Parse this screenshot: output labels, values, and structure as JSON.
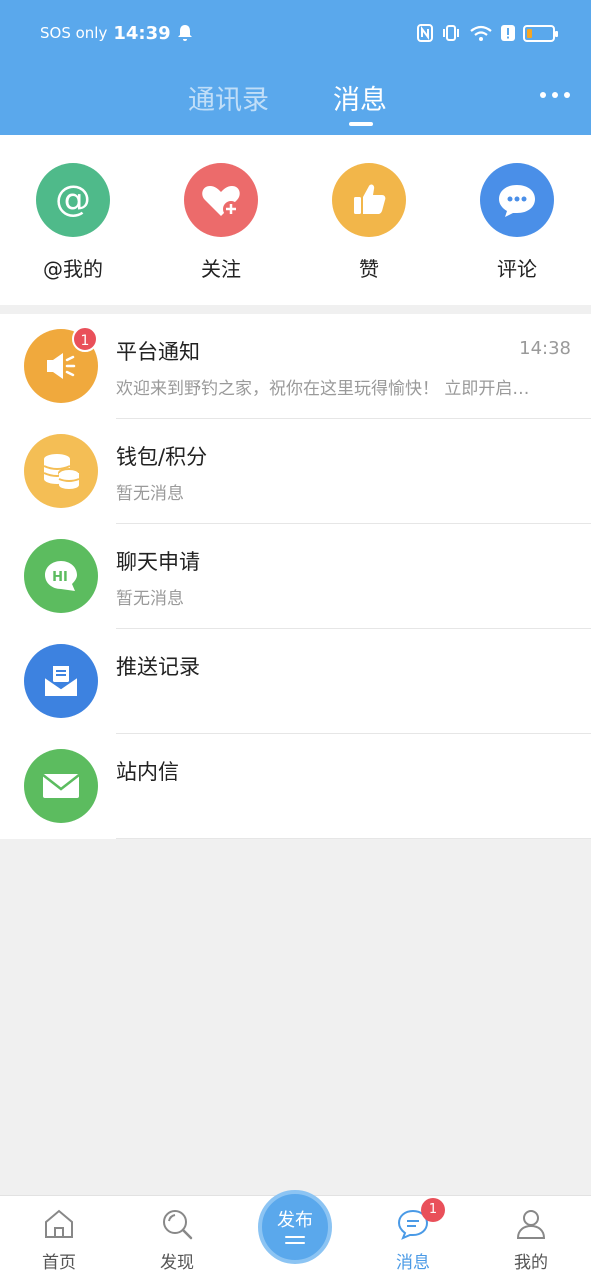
{
  "status_bar": {
    "carrier": "SOS only",
    "time": "14:39"
  },
  "header": {
    "tabs": [
      {
        "label": "通讯录",
        "active": false
      },
      {
        "label": "消息",
        "active": true
      }
    ]
  },
  "quick_actions": [
    {
      "label": "@我的",
      "icon": "at-icon",
      "color": "#4fba8a"
    },
    {
      "label": "关注",
      "icon": "heart-plus-icon",
      "color": "#ec6b6b"
    },
    {
      "label": "赞",
      "icon": "thumbs-up-icon",
      "color": "#f2b64a"
    },
    {
      "label": "评论",
      "icon": "comment-bubble-icon",
      "color": "#4a8fe8"
    }
  ],
  "messages": [
    {
      "title": "平台通知",
      "subtitle": "欢迎来到野钓之家，祝你在这里玩得愉快！ 立即开启钓鱼之旅",
      "time": "14:38",
      "badge": "1",
      "icon": "megaphone-icon",
      "color": "#f0a93d"
    },
    {
      "title": "钱包/积分",
      "subtitle": "暂无消息",
      "time": "",
      "badge": "",
      "icon": "coins-icon",
      "color": "#f4be55"
    },
    {
      "title": "聊天申请",
      "subtitle": "暂无消息",
      "time": "",
      "badge": "",
      "icon": "chat-hi-icon",
      "color": "#5cbc5f"
    },
    {
      "title": "推送记录",
      "subtitle": "",
      "time": "",
      "badge": "",
      "icon": "inbox-icon",
      "color": "#3d82e0"
    },
    {
      "title": "站内信",
      "subtitle": "",
      "time": "",
      "badge": "",
      "icon": "envelope-icon",
      "color": "#5cbc5f"
    }
  ],
  "bottom_nav": {
    "items": [
      {
        "label": "首页",
        "icon": "home-icon"
      },
      {
        "label": "发现",
        "icon": "discover-icon"
      },
      {
        "label": "消息",
        "icon": "message-icon",
        "badge": "1",
        "active": true
      },
      {
        "label": "我的",
        "icon": "profile-icon"
      }
    ],
    "publish_label": "发布"
  },
  "colors": {
    "header": "#5aa8ec",
    "accent": "#4a9ae6",
    "badge": "#e9505a"
  }
}
